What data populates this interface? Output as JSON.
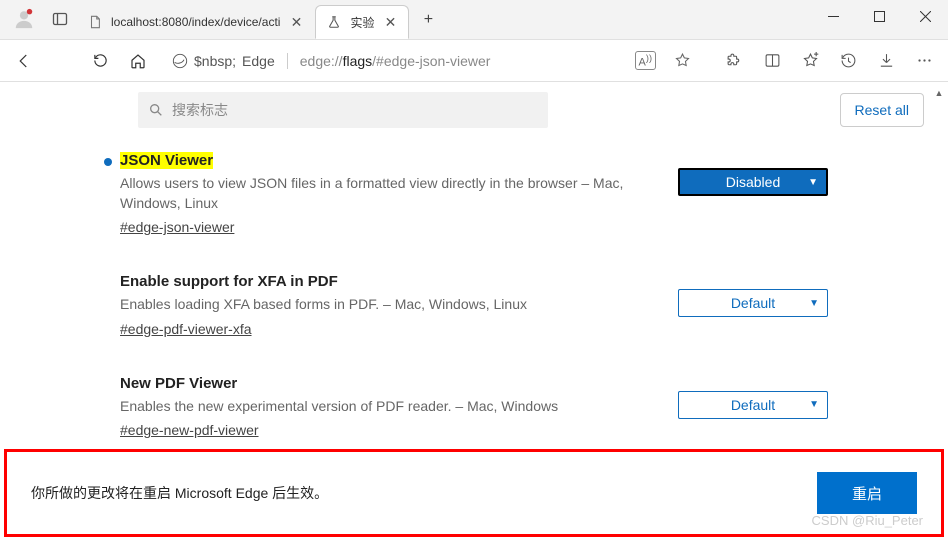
{
  "titlebar": {
    "tabs": [
      {
        "title": "localhost:8080/index/device/acti",
        "icon": "📄"
      },
      {
        "title": "实验",
        "icon": "⚗"
      }
    ]
  },
  "toolbar": {
    "edge_label": "Edge",
    "url_gray": "edge://",
    "url_dark": "flags",
    "url_tail": "/#edge-json-viewer"
  },
  "search": {
    "placeholder": "搜索标志",
    "reset_label": "Reset all"
  },
  "flags": [
    {
      "title": "JSON Viewer",
      "highlighted": true,
      "modified": true,
      "desc": "Allows users to view JSON files in a formatted view directly in the browser – Mac, Windows, Linux",
      "hash": "#edge-json-viewer",
      "value": "Disabled",
      "filled": true
    },
    {
      "title": "Enable support for XFA in PDF",
      "highlighted": false,
      "modified": false,
      "desc": "Enables loading XFA based forms in PDF. – Mac, Windows, Linux",
      "hash": "#edge-pdf-viewer-xfa",
      "value": "Default",
      "filled": false
    },
    {
      "title": "New PDF Viewer",
      "highlighted": false,
      "modified": false,
      "desc": "Enables the new experimental version of PDF reader. – Mac, Windows",
      "hash": "#edge-new-pdf-viewer",
      "value": "Default",
      "filled": false
    }
  ],
  "banner": {
    "text": "你所做的更改将在重启 Microsoft Edge 后生效。",
    "button": "重启"
  },
  "watermark": "CSDN @Riu_Peter"
}
